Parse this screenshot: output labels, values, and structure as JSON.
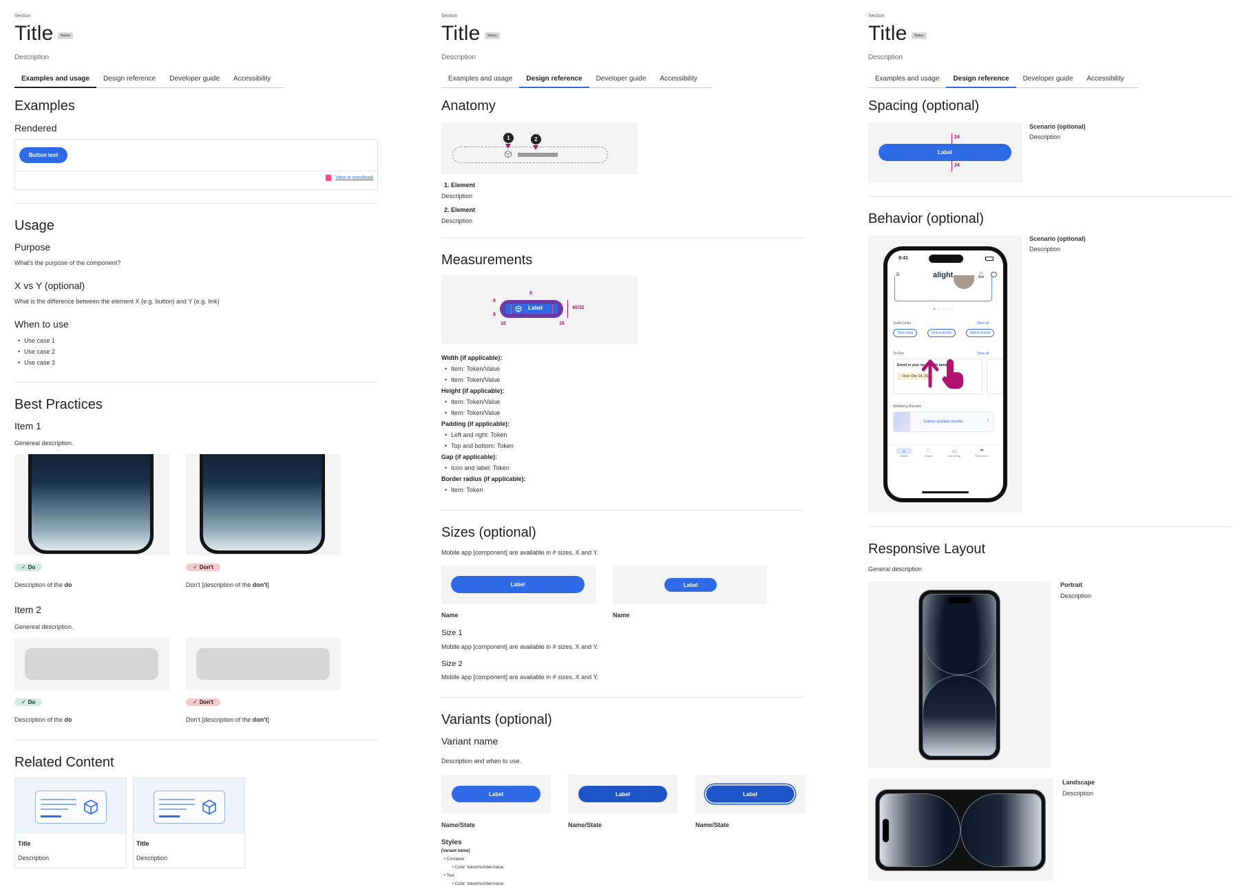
{
  "common": {
    "section": "Section",
    "title": "Title",
    "status": "Status",
    "description": "Description",
    "tabs": [
      "Examples and usage",
      "Design reference",
      "Developer guide",
      "Accessibility"
    ]
  },
  "col1": {
    "examples_heading": "Examples",
    "rendered_heading": "Rendered",
    "button_text": "Button text",
    "storybook_link": "View in storybook",
    "usage_heading": "Usage",
    "purpose_heading": "Purpose",
    "purpose_text": "What's the purpose of the component?",
    "xvy_heading": "X vs Y (optional)",
    "xvy_text": "What is the difference between the element X (e.g. button) and Y (e.g. link)",
    "when_heading": "When to use",
    "use_cases": [
      "Use case 1",
      "Use case 2",
      "Use case 3"
    ],
    "best_heading": "Best Practices",
    "item1_heading": "Item 1",
    "item2_heading": "Item 2",
    "general_desc": "Genereal description.",
    "do_label": "Do",
    "dont_label": "Don't",
    "do_desc_prefix": "Description of the ",
    "do_desc_bold": "do",
    "dont_desc_prefix": "Don't [description of the ",
    "dont_desc_bold": "don't",
    "dont_desc_suffix": "]",
    "related_heading": "Related Content",
    "cards": [
      {
        "title": "Title",
        "description": "Description"
      },
      {
        "title": "Title",
        "description": "Description"
      }
    ]
  },
  "col2": {
    "anatomy_heading": "Anatomy",
    "anatomy_items": [
      {
        "label": "1. Element",
        "description": "Description"
      },
      {
        "label": "2. Element",
        "description": "Description"
      }
    ],
    "measurements_heading": "Measurements",
    "meas_label": "Label",
    "meas_numbers": {
      "top": "8",
      "left_top": "8",
      "left_bottom": "8",
      "left16": "16",
      "right16": "16",
      "height": "40/32"
    },
    "spec_groups": [
      {
        "title": "Width (if applicable):",
        "items": [
          "Item: Token/Value",
          "Item: Token/Value"
        ]
      },
      {
        "title": "Height (if applicable):",
        "items": [
          "Item: Token/Value",
          "Item: Token/Value"
        ]
      },
      {
        "title": "Padding (if applicable):",
        "items": [
          "Left and right: Token",
          "Top and bottom: Token"
        ]
      },
      {
        "title": "Gap (if applicable):",
        "items": [
          "Icon and label: Token"
        ]
      },
      {
        "title": "Border radius (if applicable):",
        "items": [
          "Item: Token"
        ]
      }
    ],
    "sizes_heading": "Sizes (optional)",
    "sizes_desc": "Mobile app [component] are available in # sizes, X and Y.",
    "label": "Label",
    "name": "Name",
    "size1": "Size 1",
    "size2": "Size 2",
    "variants_heading": "Variants (optional)",
    "variant_name": "Variant name",
    "variant_desc": "Description and when to use.",
    "name_state": "Name/State",
    "styles_heading": "Styles",
    "styles_variant": "[Variant name]",
    "styles_container": "Container",
    "styles_text": "Text",
    "styles_color": "Color: token/number/value"
  },
  "col3": {
    "spacing_heading": "Spacing (optional)",
    "scenario": "Scenario (optional)",
    "spacing_value": "24",
    "behavior_heading": "Behavior (optional)",
    "phone": {
      "time": "9:41",
      "brand": "alight",
      "quick_links": "Quick Links",
      "view_all": "View all",
      "chips": [
        "Time entry",
        "Find a doctor",
        "Add & review"
      ],
      "todos": "To-Dos",
      "enroll": "Enroll in your new health benefits",
      "due": "Due: Dec 14, 2023",
      "wellbeing": "Wellbeing Benefits",
      "explore": "Explore available benefits",
      "nav": [
        "Home",
        "Health",
        "Job & Pay",
        "Retirement"
      ]
    },
    "responsive_heading": "Responsive Layout",
    "general_description": "General description",
    "portrait": "Portrait",
    "landscape": "Landscape"
  },
  "colors": {
    "accent": "#2e6ae6",
    "magenta": "#b0136f",
    "do_bg": "#cfeee0",
    "dont_bg": "#f7c9c9"
  }
}
